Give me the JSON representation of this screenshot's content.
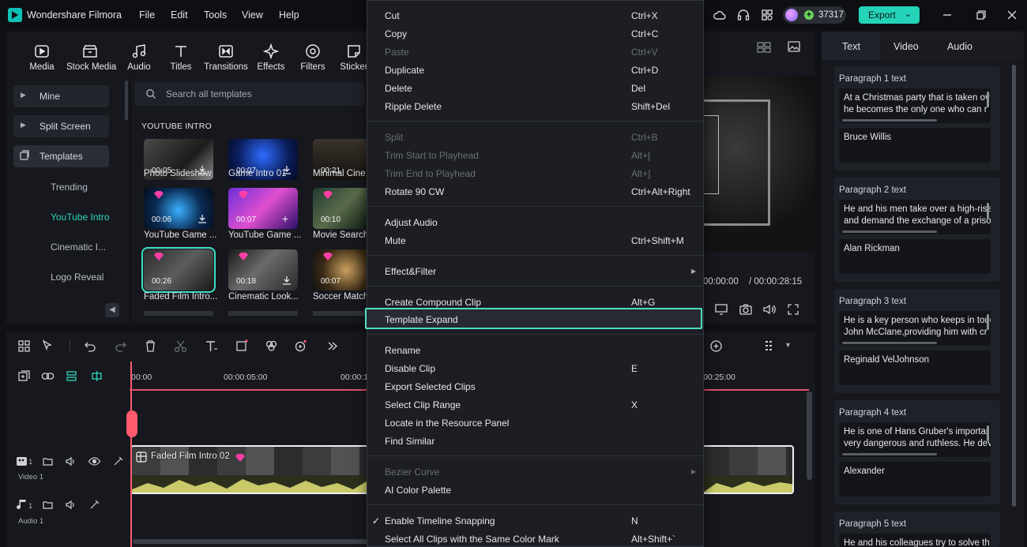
{
  "app": {
    "name": "Wondershare Filmora",
    "credits": "37317",
    "export_label": "Export"
  },
  "menu": [
    "File",
    "Edit",
    "Tools",
    "View",
    "Help"
  ],
  "media_tools": [
    "Media",
    "Stock Media",
    "Audio",
    "Titles",
    "Transitions",
    "Effects",
    "Filters",
    "Sticker"
  ],
  "sidebar": {
    "items": [
      "Mine",
      "Split Screen",
      "Templates"
    ],
    "sub_items": [
      "Trending",
      "YouTube Intro",
      "Cinematic I...",
      "Logo Reveal"
    ]
  },
  "browser": {
    "search_placeholder": "Search all templates",
    "section": "YOUTUBE INTRO",
    "thumbs": [
      {
        "label": "Photo Slideshow",
        "duration": "00:05"
      },
      {
        "label": "Game Intro 01",
        "duration": "00:07"
      },
      {
        "label": "Minimal Cine",
        "duration": "00:21"
      },
      {
        "label": "YouTube Game ...",
        "duration": "00:06"
      },
      {
        "label": "YouTube Game ...",
        "duration": "00:07"
      },
      {
        "label": "Movie Search",
        "duration": "00:10"
      },
      {
        "label": "Faded Film Intro...",
        "duration": "00:26"
      },
      {
        "label": "Cinematic Look...",
        "duration": "00:18"
      },
      {
        "label": "Soccer Match",
        "duration": "00:07"
      }
    ]
  },
  "player": {
    "current_time": "00:00:00",
    "total_time": "/ 00:00:28:15"
  },
  "props": {
    "tabs": [
      "Text",
      "Video",
      "Audio"
    ],
    "paragraphs": [
      {
        "title": "Paragraph 1 text",
        "body": "At a Christmas party that is taken ov he becomes the only one who can r",
        "name": "Bruce Willis"
      },
      {
        "title": "Paragraph 2 text",
        "body": "He and his men take over a high-rise and demand the exchange of a priso",
        "name": "Alan Rickman"
      },
      {
        "title": "Paragraph 3 text",
        "body": "He is a key person who keeps in touc John McClane,providing him with cr",
        "name": "Reginald VelJohnson"
      },
      {
        "title": "Paragraph 4 text",
        "body": "He is one of Hans Gruber's importar very dangerous and ruthless. He dev",
        "name": "Alexander"
      },
      {
        "title": "Paragraph 5 text",
        "body": "He and his colleagues try to solve th",
        "name": ""
      }
    ]
  },
  "timeline": {
    "ruler": [
      "00:00",
      "00:00:05:00",
      "00:00:1",
      "00:25:00"
    ],
    "clip_name": "Faded Film Intro 02",
    "tracks": [
      "Video 1",
      "Audio 1"
    ],
    "track_nums": [
      "1",
      "1"
    ]
  },
  "context_menu": [
    {
      "label": "Cut",
      "shortcut": "Ctrl+X",
      "disabled": false
    },
    {
      "label": "Copy",
      "shortcut": "Ctrl+C",
      "disabled": false
    },
    {
      "label": "Paste",
      "shortcut": "Ctrl+V",
      "disabled": true
    },
    {
      "label": "Duplicate",
      "shortcut": "Ctrl+D",
      "disabled": false
    },
    {
      "label": "Delete",
      "shortcut": "Del",
      "disabled": false
    },
    {
      "label": "Ripple Delete",
      "shortcut": "Shift+Del",
      "disabled": false
    },
    {
      "label": "Split",
      "shortcut": "Ctrl+B",
      "disabled": true
    },
    {
      "label": "Trim Start to Playhead",
      "shortcut": "Alt+[",
      "disabled": true
    },
    {
      "label": "Trim End to Playhead",
      "shortcut": "Alt+]",
      "disabled": true
    },
    {
      "label": "Rotate 90 CW",
      "shortcut": "Ctrl+Alt+Right",
      "disabled": false
    },
    {
      "label": "Adjust Audio",
      "shortcut": "",
      "disabled": false
    },
    {
      "label": "Mute",
      "shortcut": "Ctrl+Shift+M",
      "disabled": false
    },
    {
      "label": "Effect&Filter",
      "shortcut": "",
      "disabled": false,
      "submenu": true
    },
    {
      "label": "Create Compound Clip",
      "shortcut": "Alt+G",
      "disabled": false
    },
    {
      "label": "Template Expand",
      "shortcut": "",
      "disabled": false,
      "highlighted": true
    },
    {
      "label": "Rename",
      "shortcut": "",
      "disabled": false
    },
    {
      "label": "Disable Clip",
      "shortcut": "E",
      "disabled": false
    },
    {
      "label": "Export Selected Clips",
      "shortcut": "",
      "disabled": false
    },
    {
      "label": "Select Clip Range",
      "shortcut": "X",
      "disabled": false
    },
    {
      "label": "Locate in the Resource Panel",
      "shortcut": "",
      "disabled": false
    },
    {
      "label": "Find Similar",
      "shortcut": "",
      "disabled": false
    },
    {
      "label": "Bezier Curve",
      "shortcut": "",
      "disabled": true,
      "submenu": true
    },
    {
      "label": "AI Color Palette",
      "shortcut": "",
      "disabled": false
    },
    {
      "label": "Enable Timeline Snapping",
      "shortcut": "N",
      "disabled": false,
      "checked": true
    },
    {
      "label": "Select All Clips with the Same Color Mark",
      "shortcut": "Alt+Shift+`",
      "disabled": false
    }
  ],
  "colors": {
    "accent": "#24d3b8",
    "highlight_border": "#4fdcc2",
    "playhead": "#ff5a6e",
    "bg": "#16181e"
  }
}
